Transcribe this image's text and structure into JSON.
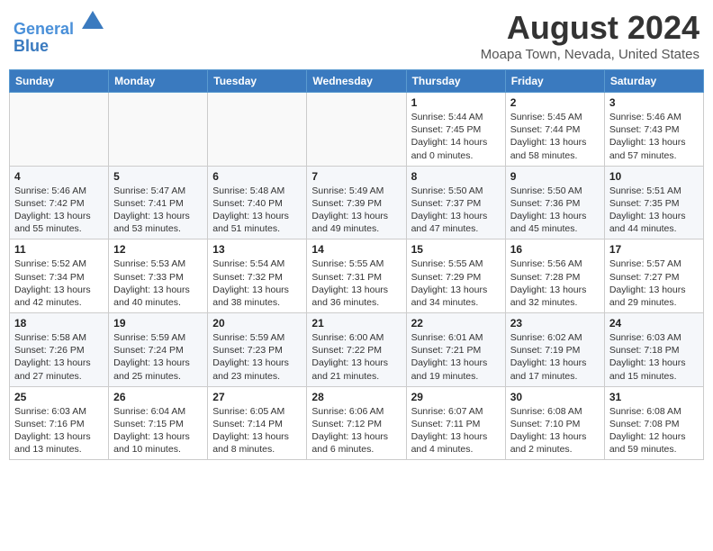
{
  "header": {
    "logo_line1": "General",
    "logo_line2": "Blue",
    "title": "August 2024",
    "subtitle": "Moapa Town, Nevada, United States"
  },
  "weekdays": [
    "Sunday",
    "Monday",
    "Tuesday",
    "Wednesday",
    "Thursday",
    "Friday",
    "Saturday"
  ],
  "weeks": [
    [
      {
        "day": "",
        "info": ""
      },
      {
        "day": "",
        "info": ""
      },
      {
        "day": "",
        "info": ""
      },
      {
        "day": "",
        "info": ""
      },
      {
        "day": "1",
        "info": "Sunrise: 5:44 AM\nSunset: 7:45 PM\nDaylight: 14 hours\nand 0 minutes."
      },
      {
        "day": "2",
        "info": "Sunrise: 5:45 AM\nSunset: 7:44 PM\nDaylight: 13 hours\nand 58 minutes."
      },
      {
        "day": "3",
        "info": "Sunrise: 5:46 AM\nSunset: 7:43 PM\nDaylight: 13 hours\nand 57 minutes."
      }
    ],
    [
      {
        "day": "4",
        "info": "Sunrise: 5:46 AM\nSunset: 7:42 PM\nDaylight: 13 hours\nand 55 minutes."
      },
      {
        "day": "5",
        "info": "Sunrise: 5:47 AM\nSunset: 7:41 PM\nDaylight: 13 hours\nand 53 minutes."
      },
      {
        "day": "6",
        "info": "Sunrise: 5:48 AM\nSunset: 7:40 PM\nDaylight: 13 hours\nand 51 minutes."
      },
      {
        "day": "7",
        "info": "Sunrise: 5:49 AM\nSunset: 7:39 PM\nDaylight: 13 hours\nand 49 minutes."
      },
      {
        "day": "8",
        "info": "Sunrise: 5:50 AM\nSunset: 7:37 PM\nDaylight: 13 hours\nand 47 minutes."
      },
      {
        "day": "9",
        "info": "Sunrise: 5:50 AM\nSunset: 7:36 PM\nDaylight: 13 hours\nand 45 minutes."
      },
      {
        "day": "10",
        "info": "Sunrise: 5:51 AM\nSunset: 7:35 PM\nDaylight: 13 hours\nand 44 minutes."
      }
    ],
    [
      {
        "day": "11",
        "info": "Sunrise: 5:52 AM\nSunset: 7:34 PM\nDaylight: 13 hours\nand 42 minutes."
      },
      {
        "day": "12",
        "info": "Sunrise: 5:53 AM\nSunset: 7:33 PM\nDaylight: 13 hours\nand 40 minutes."
      },
      {
        "day": "13",
        "info": "Sunrise: 5:54 AM\nSunset: 7:32 PM\nDaylight: 13 hours\nand 38 minutes."
      },
      {
        "day": "14",
        "info": "Sunrise: 5:55 AM\nSunset: 7:31 PM\nDaylight: 13 hours\nand 36 minutes."
      },
      {
        "day": "15",
        "info": "Sunrise: 5:55 AM\nSunset: 7:29 PM\nDaylight: 13 hours\nand 34 minutes."
      },
      {
        "day": "16",
        "info": "Sunrise: 5:56 AM\nSunset: 7:28 PM\nDaylight: 13 hours\nand 32 minutes."
      },
      {
        "day": "17",
        "info": "Sunrise: 5:57 AM\nSunset: 7:27 PM\nDaylight: 13 hours\nand 29 minutes."
      }
    ],
    [
      {
        "day": "18",
        "info": "Sunrise: 5:58 AM\nSunset: 7:26 PM\nDaylight: 13 hours\nand 27 minutes."
      },
      {
        "day": "19",
        "info": "Sunrise: 5:59 AM\nSunset: 7:24 PM\nDaylight: 13 hours\nand 25 minutes."
      },
      {
        "day": "20",
        "info": "Sunrise: 5:59 AM\nSunset: 7:23 PM\nDaylight: 13 hours\nand 23 minutes."
      },
      {
        "day": "21",
        "info": "Sunrise: 6:00 AM\nSunset: 7:22 PM\nDaylight: 13 hours\nand 21 minutes."
      },
      {
        "day": "22",
        "info": "Sunrise: 6:01 AM\nSunset: 7:21 PM\nDaylight: 13 hours\nand 19 minutes."
      },
      {
        "day": "23",
        "info": "Sunrise: 6:02 AM\nSunset: 7:19 PM\nDaylight: 13 hours\nand 17 minutes."
      },
      {
        "day": "24",
        "info": "Sunrise: 6:03 AM\nSunset: 7:18 PM\nDaylight: 13 hours\nand 15 minutes."
      }
    ],
    [
      {
        "day": "25",
        "info": "Sunrise: 6:03 AM\nSunset: 7:16 PM\nDaylight: 13 hours\nand 13 minutes."
      },
      {
        "day": "26",
        "info": "Sunrise: 6:04 AM\nSunset: 7:15 PM\nDaylight: 13 hours\nand 10 minutes."
      },
      {
        "day": "27",
        "info": "Sunrise: 6:05 AM\nSunset: 7:14 PM\nDaylight: 13 hours\nand 8 minutes."
      },
      {
        "day": "28",
        "info": "Sunrise: 6:06 AM\nSunset: 7:12 PM\nDaylight: 13 hours\nand 6 minutes."
      },
      {
        "day": "29",
        "info": "Sunrise: 6:07 AM\nSunset: 7:11 PM\nDaylight: 13 hours\nand 4 minutes."
      },
      {
        "day": "30",
        "info": "Sunrise: 6:08 AM\nSunset: 7:10 PM\nDaylight: 13 hours\nand 2 minutes."
      },
      {
        "day": "31",
        "info": "Sunrise: 6:08 AM\nSunset: 7:08 PM\nDaylight: 12 hours\nand 59 minutes."
      }
    ]
  ]
}
